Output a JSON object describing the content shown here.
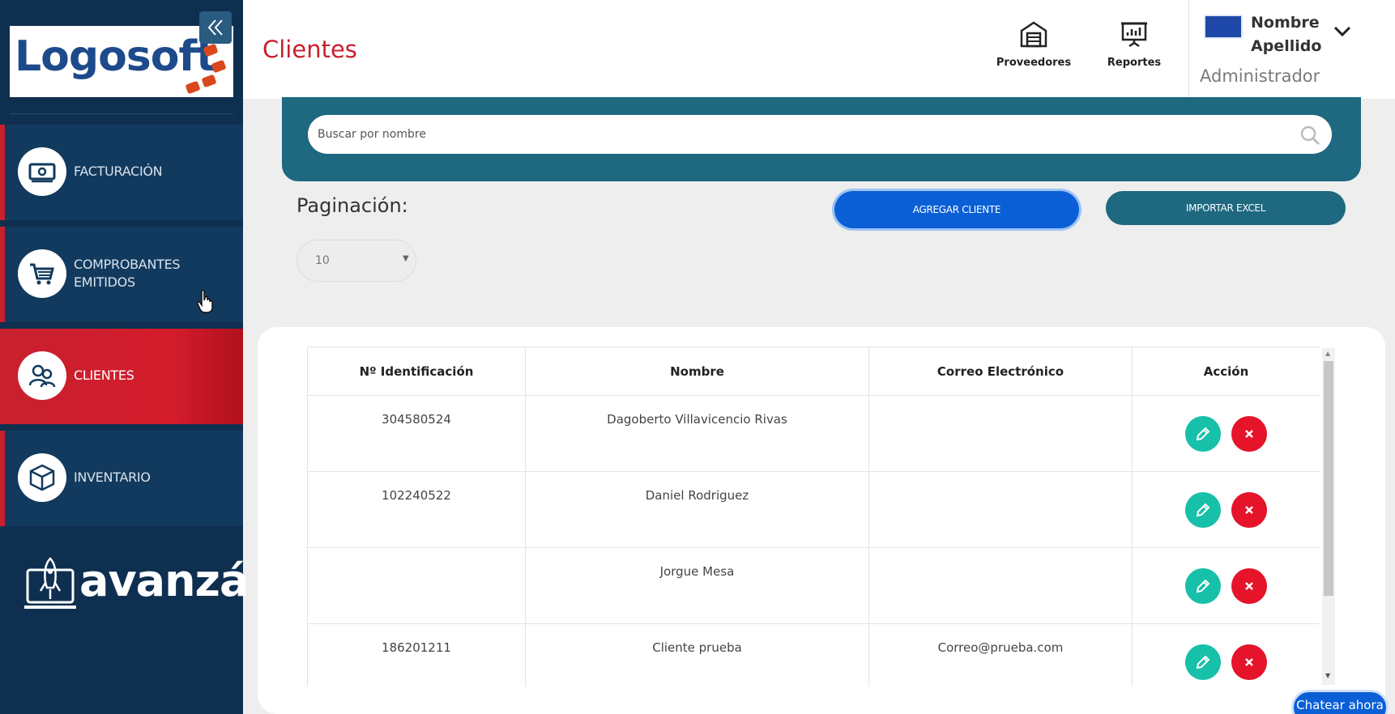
{
  "sidebar": {
    "logo": "Logosoft",
    "items": [
      {
        "label": "FACTURACIÓN",
        "icon": "money-icon"
      },
      {
        "label": "COMPROBANTES EMITIDOS",
        "icon": "cart-icon"
      },
      {
        "label": "CLIENTES",
        "icon": "users-icon",
        "active": true
      },
      {
        "label": "INVENTARIO",
        "icon": "box-icon"
      }
    ],
    "brand": "avanzá"
  },
  "header": {
    "title": "Clientes",
    "buttons": [
      {
        "label": "Proveedores",
        "icon": "warehouse-icon"
      },
      {
        "label": "Reportes",
        "icon": "presentation-chart-icon"
      }
    ],
    "user": {
      "first_name": "Nombre",
      "last_name": "Apellido",
      "role": "Administrador"
    }
  },
  "search": {
    "placeholder": "Buscar por nombre"
  },
  "pagination": {
    "label": "Paginación:",
    "value": "10"
  },
  "actions": {
    "add": "AGREGAR CLIENTE",
    "import": "IMPORTAR EXCEL"
  },
  "table": {
    "headers": [
      "Nº Identificación",
      "Nombre",
      "Correo Electrónico",
      "Acción"
    ],
    "rows": [
      {
        "id": "304580524",
        "name": "Dagoberto Villavicencio Rivas",
        "email": ""
      },
      {
        "id": "102240522",
        "name": "Daniel Rodriguez",
        "email": ""
      },
      {
        "id": "",
        "name": "Jorgue Mesa",
        "email": ""
      },
      {
        "id": "186201211",
        "name": "Cliente prueba",
        "email": "Correo@prueba.com"
      }
    ]
  },
  "chat": {
    "label": "Chatear ahora"
  },
  "colors": {
    "sidebar": "#0f2f50",
    "accent_red": "#c8202e",
    "teal": "#1e6880",
    "primary_blue": "#0b5fd6",
    "edit": "#17c0a8",
    "delete": "#e5142a"
  }
}
